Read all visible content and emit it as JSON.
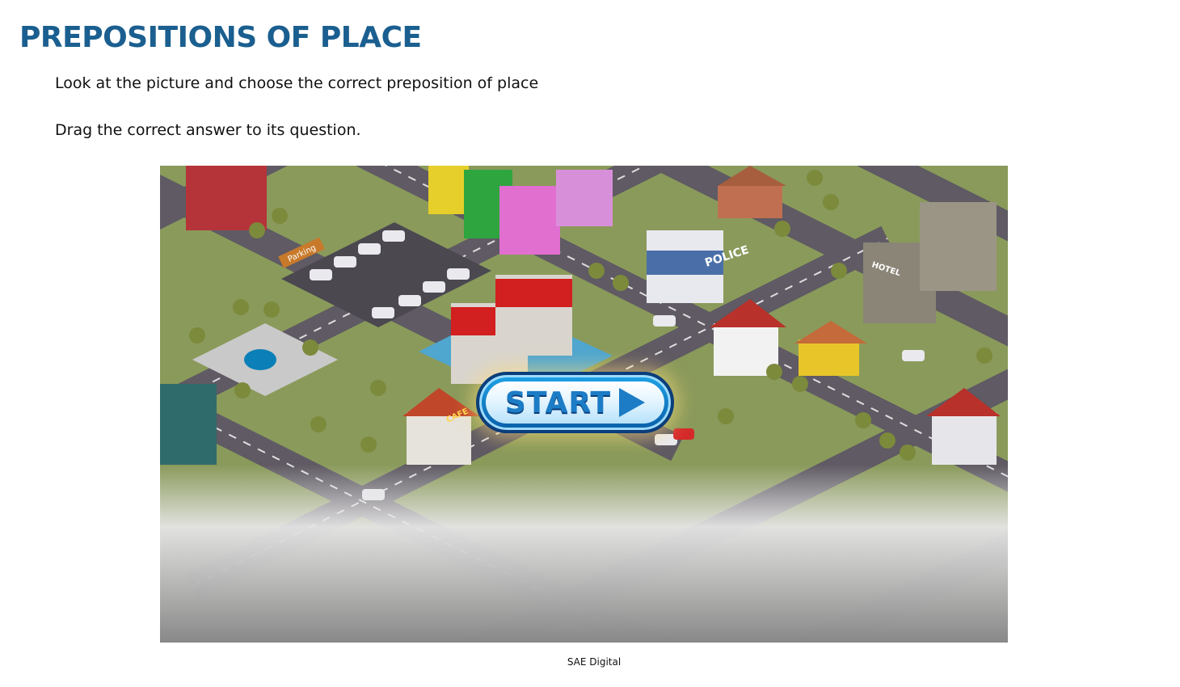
{
  "page": {
    "title": "PREPOSITIONS OF PLACE",
    "instruction_1": "Look at the picture and choose the correct preposition of place",
    "instruction_2": "Drag the correct answer to its question."
  },
  "game": {
    "start_label": "START",
    "signs": {
      "parking": "Parking",
      "police": "POLICE",
      "hotel": "HOTEL",
      "cafe": "CAFE"
    }
  },
  "footer": {
    "credit": "SAE Digital"
  },
  "colors": {
    "title": "#1a5f8f",
    "grass": "#8a9a5b",
    "road": "#5f5a63",
    "start_accent": "#1c7cc6"
  }
}
